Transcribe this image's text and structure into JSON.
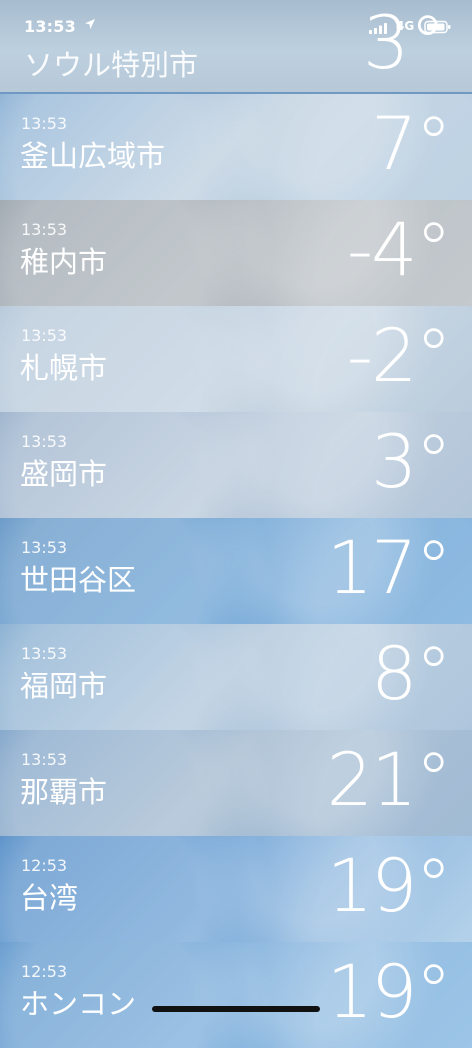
{
  "status_bar": {
    "time": "13:53",
    "network": "4G"
  },
  "partial_top": {
    "name": "ソウル特別市",
    "temp": "3°"
  },
  "rows": [
    {
      "time": "13:53",
      "name": "釜山広域市",
      "temp": "7°"
    },
    {
      "time": "13:53",
      "name": "稚内市",
      "temp": "-4°"
    },
    {
      "time": "13:53",
      "name": "札幌市",
      "temp": "-2°"
    },
    {
      "time": "13:53",
      "name": "盛岡市",
      "temp": "3°"
    },
    {
      "time": "13:53",
      "name": "世田谷区",
      "temp": "17°"
    },
    {
      "time": "13:53",
      "name": "福岡市",
      "temp": "8°"
    },
    {
      "time": "13:53",
      "name": "那覇市",
      "temp": "21°"
    },
    {
      "time": "12:53",
      "name": "台湾",
      "temp": "19°"
    },
    {
      "time": "12:53",
      "name": "ホンコン",
      "temp": "19°"
    }
  ],
  "icons": {
    "location": "location-arrow-icon",
    "signal": "signal-bars-icon",
    "battery": "battery-icon"
  }
}
